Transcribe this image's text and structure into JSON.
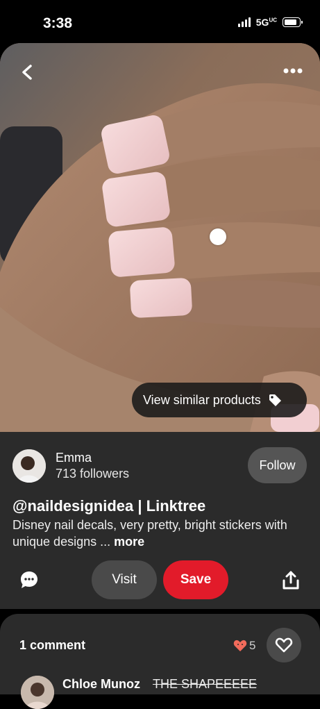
{
  "status_bar": {
    "time": "3:38",
    "network": "5G",
    "network_sup": "UC"
  },
  "image_overlay": {
    "similar_label": "View similar products"
  },
  "author": {
    "name": "Emma",
    "followers": "713 followers",
    "follow_label": "Follow"
  },
  "pin": {
    "title": "@naildesignidea | Linktree",
    "description": "Disney nail decals, very pretty, bright stickers with unique designs ...",
    "more_label": "more"
  },
  "actions": {
    "visit_label": "Visit",
    "save_label": "Save"
  },
  "comments": {
    "title": "1 comment",
    "reaction_count": "5",
    "first_comment_author": "Chloe Munoz",
    "first_comment_text": "THE SHAPEEEEE"
  },
  "icons": {
    "back": "chevron-left-icon",
    "more": "more-horizontal-icon",
    "tag": "tag-icon",
    "comment": "comment-icon",
    "share": "share-icon",
    "heart": "heart-icon"
  },
  "colors": {
    "save": "#e21b2a",
    "panel": "#2b2b2b",
    "button_gray": "#4a4a4a",
    "reaction_heart": "#f26b5b"
  }
}
